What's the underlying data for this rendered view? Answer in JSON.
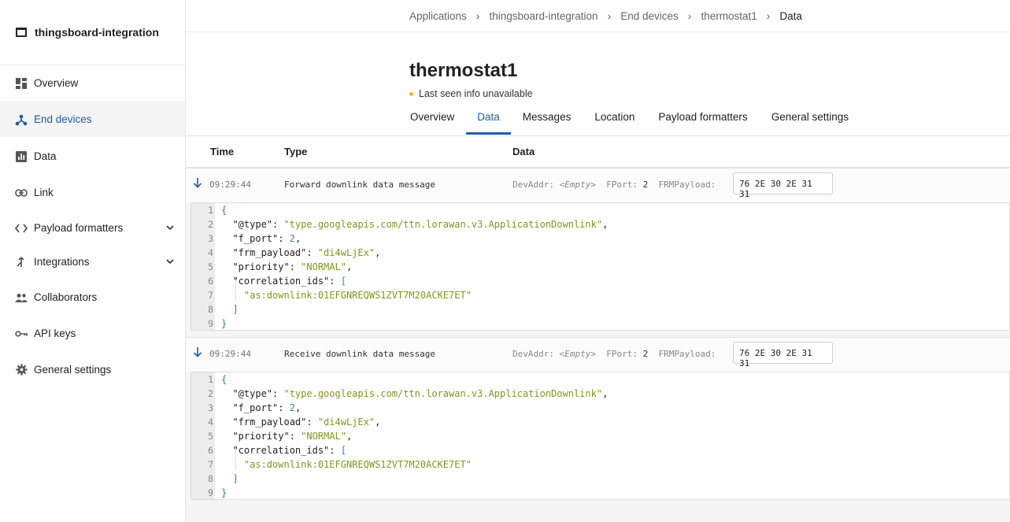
{
  "app": {
    "name": "thingsboard-integration"
  },
  "sidebar": {
    "items": [
      {
        "label": "Overview",
        "icon": "dashboard-icon"
      },
      {
        "label": "End devices",
        "icon": "devices-icon"
      },
      {
        "label": "Data",
        "icon": "bar-chart-icon"
      },
      {
        "label": "Link",
        "icon": "link-icon"
      },
      {
        "label": "Payload formatters",
        "icon": "code-icon"
      },
      {
        "label": "Integrations",
        "icon": "merge-icon"
      },
      {
        "label": "Collaborators",
        "icon": "people-icon"
      },
      {
        "label": "API keys",
        "icon": "key-icon"
      },
      {
        "label": "General settings",
        "icon": "gear-icon"
      }
    ]
  },
  "breadcrumb": {
    "items": [
      "Applications",
      "thingsboard-integration",
      "End devices",
      "thermostat1",
      "Data"
    ]
  },
  "device": {
    "title": "thermostat1",
    "status": "Last seen info unavailable",
    "status_color": "#f0b429"
  },
  "tabs": [
    "Overview",
    "Data",
    "Messages",
    "Location",
    "Payload formatters",
    "General settings"
  ],
  "table": {
    "headers": {
      "time": "Time",
      "type": "Type",
      "data": "Data"
    }
  },
  "events": [
    {
      "time": "09:29:44",
      "type": "Forward downlink data message",
      "devaddr_label": "DevAddr:",
      "devaddr_value": "<Empty>",
      "fport_label": "FPort:",
      "fport_value": "2",
      "frmpayload_label": "FRMPayload:",
      "frmpayload_value": "76 2E 30 2E 31 31",
      "json": {
        "l1": "{",
        "type_key": "\"@type\"",
        "type_val": "\"type.googleapis.com/ttn.lorawan.v3.ApplicationDownlink\"",
        "fport_key": "\"f_port\"",
        "fport_val": "2",
        "frm_key": "\"frm_payload\"",
        "frm_val": "\"di4wLjEx\"",
        "prio_key": "\"priority\"",
        "prio_val": "\"NORMAL\"",
        "corr_key": "\"correlation_ids\"",
        "corr_item": "\"as:downlink:01EFGNREQWS1ZVT7M20ACKE7ET\"",
        "close_arr": "]",
        "close": "}"
      }
    },
    {
      "time": "09:29:44",
      "type": "Receive downlink data message",
      "devaddr_label": "DevAddr:",
      "devaddr_value": "<Empty>",
      "fport_label": "FPort:",
      "fport_value": "2",
      "frmpayload_label": "FRMPayload:",
      "frmpayload_value": "76 2E 30 2E 31 31",
      "json": {
        "l1": "{",
        "type_key": "\"@type\"",
        "type_val": "\"type.googleapis.com/ttn.lorawan.v3.ApplicationDownlink\"",
        "fport_key": "\"f_port\"",
        "fport_val": "2",
        "frm_key": "\"frm_payload\"",
        "frm_val": "\"di4wLjEx\"",
        "prio_key": "\"priority\"",
        "prio_val": "\"NORMAL\"",
        "corr_key": "\"correlation_ids\"",
        "corr_item": "\"as:downlink:01EFGNREQWS1ZVT7M20ACKE7ET\"",
        "close_arr": "]",
        "close": "}"
      }
    }
  ],
  "line_numbers": [
    "1",
    "2",
    "3",
    "4",
    "5",
    "6",
    "7",
    "8",
    "9"
  ],
  "colors": {
    "accent": "#1c5fa8",
    "json_string": "#7a9a1a",
    "json_number": "#3a8a8a",
    "json_bracket": "#2f7fbf"
  }
}
